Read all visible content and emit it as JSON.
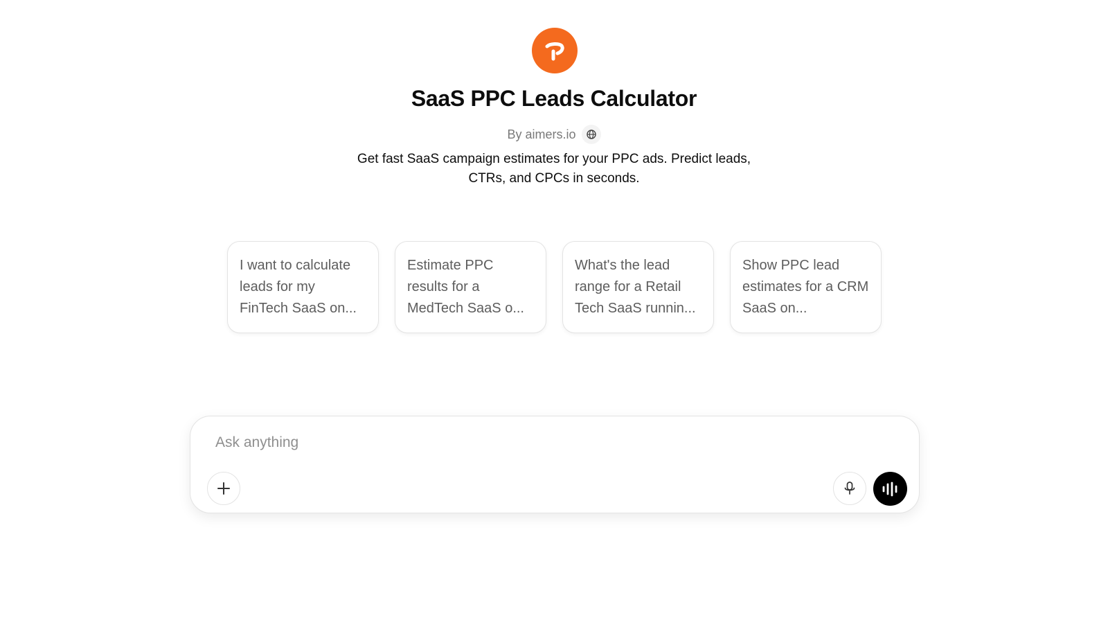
{
  "gpt": {
    "title": "SaaS PPC Leads Calculator",
    "byline": "By aimers.io",
    "description": "Get fast SaaS campaign estimates for your PPC ads. Predict leads, CTRs, and CPCs in seconds.",
    "logo_icon": "orange-arrow-logo-icon",
    "logo_color": "#f46a1e"
  },
  "conversation_starters": [
    {
      "label": "I want to calculate leads for my FinTech SaaS on..."
    },
    {
      "label": "Estimate PPC results for a MedTech SaaS o..."
    },
    {
      "label": "What's the lead range for a Retail Tech SaaS runnin..."
    },
    {
      "label": "Show PPC lead estimates for a CRM SaaS on..."
    }
  ],
  "composer": {
    "placeholder": "Ask anything",
    "value": "",
    "icons": {
      "attach": "plus-icon",
      "dictate": "microphone-icon",
      "voice": "voice-mode-icon"
    }
  }
}
